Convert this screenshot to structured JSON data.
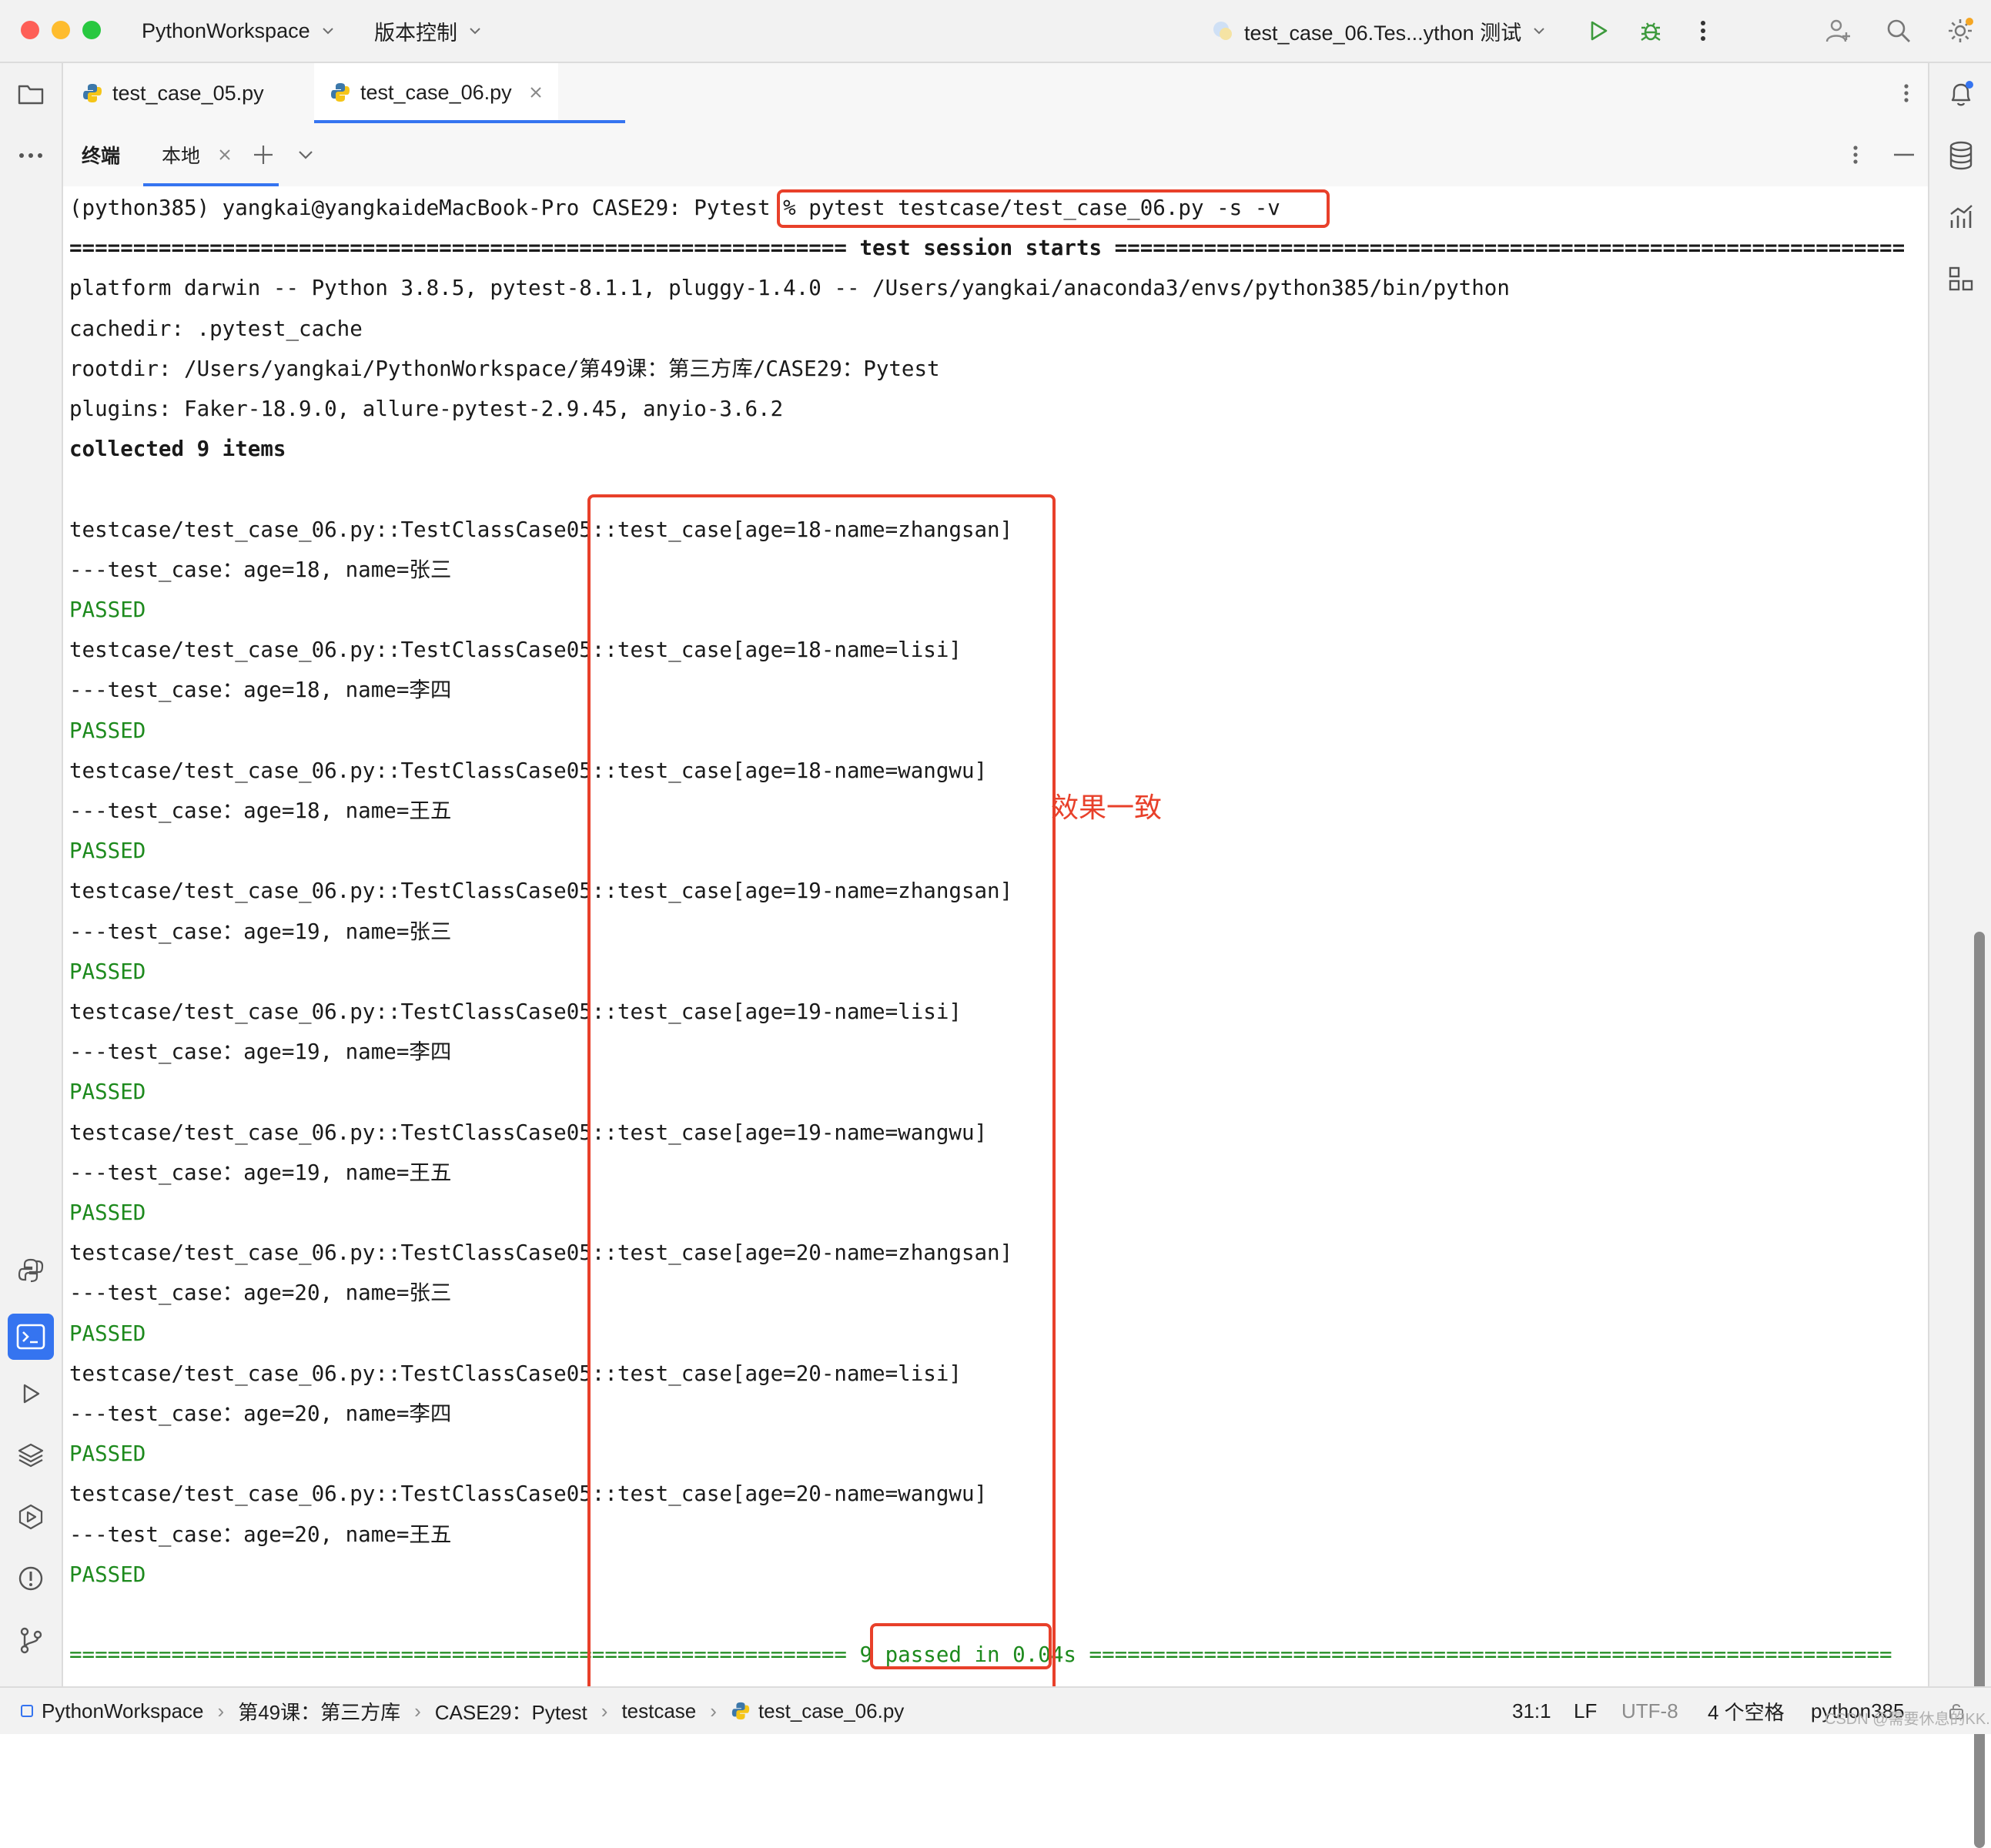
{
  "window": {
    "project": "PythonWorkspace",
    "vcs": "版本控制",
    "run_config": "test_case_06.Tes...ython 测试"
  },
  "editor_tabs": [
    {
      "label": "test_case_05.py",
      "active": false
    },
    {
      "label": "test_case_06.py",
      "active": true
    }
  ],
  "terminal_tabs": {
    "title": "终端",
    "local": "本地"
  },
  "terminal": {
    "lines": [
      {
        "text": "(python385) yangkai@yangkaideMacBook-Pro CASE29: Pytest % pytest testcase/test_case_06.py -s -v",
        "style": "normal"
      },
      {
        "text": "============================================================= test session starts ==============================================================",
        "style": "bold"
      },
      {
        "text": "platform darwin -- Python 3.8.5, pytest-8.1.1, pluggy-1.4.0 -- /Users/yangkai/anaconda3/envs/python385/bin/python",
        "style": "normal"
      },
      {
        "text": "cachedir: .pytest_cache",
        "style": "normal"
      },
      {
        "text": "rootdir: /Users/yangkai/PythonWorkspace/第49课：第三方库/CASE29：Pytest",
        "style": "normal"
      },
      {
        "text": "plugins: Faker-18.9.0, allure-pytest-2.9.45, anyio-3.6.2",
        "style": "normal"
      },
      {
        "text": "collected 9 items",
        "style": "bold"
      },
      {
        "text": "",
        "style": "normal"
      },
      {
        "text": "testcase/test_case_06.py::TestClassCase05::test_case[age=18-name=zhangsan]",
        "style": "normal"
      },
      {
        "text": "---test_case：age=18, name=张三",
        "style": "normal"
      },
      {
        "text": "PASSED",
        "style": "green"
      },
      {
        "text": "testcase/test_case_06.py::TestClassCase05::test_case[age=18-name=lisi]",
        "style": "normal"
      },
      {
        "text": "---test_case：age=18, name=李四",
        "style": "normal"
      },
      {
        "text": "PASSED",
        "style": "green"
      },
      {
        "text": "testcase/test_case_06.py::TestClassCase05::test_case[age=18-name=wangwu]",
        "style": "normal"
      },
      {
        "text": "---test_case：age=18, name=王五",
        "style": "normal"
      },
      {
        "text": "PASSED",
        "style": "green"
      },
      {
        "text": "testcase/test_case_06.py::TestClassCase05::test_case[age=19-name=zhangsan]",
        "style": "normal"
      },
      {
        "text": "---test_case：age=19, name=张三",
        "style": "normal"
      },
      {
        "text": "PASSED",
        "style": "green"
      },
      {
        "text": "testcase/test_case_06.py::TestClassCase05::test_case[age=19-name=lisi]",
        "style": "normal"
      },
      {
        "text": "---test_case：age=19, name=李四",
        "style": "normal"
      },
      {
        "text": "PASSED",
        "style": "green"
      },
      {
        "text": "testcase/test_case_06.py::TestClassCase05::test_case[age=19-name=wangwu]",
        "style": "normal"
      },
      {
        "text": "---test_case：age=19, name=王五",
        "style": "normal"
      },
      {
        "text": "PASSED",
        "style": "green"
      },
      {
        "text": "testcase/test_case_06.py::TestClassCase05::test_case[age=20-name=zhangsan]",
        "style": "normal"
      },
      {
        "text": "---test_case：age=20, name=张三",
        "style": "normal"
      },
      {
        "text": "PASSED",
        "style": "green"
      },
      {
        "text": "testcase/test_case_06.py::TestClassCase05::test_case[age=20-name=lisi]",
        "style": "normal"
      },
      {
        "text": "---test_case：age=20, name=李四",
        "style": "normal"
      },
      {
        "text": "PASSED",
        "style": "green"
      },
      {
        "text": "testcase/test_case_06.py::TestClassCase05::test_case[age=20-name=wangwu]",
        "style": "normal"
      },
      {
        "text": "---test_case：age=20, name=王五",
        "style": "normal"
      },
      {
        "text": "PASSED",
        "style": "green"
      },
      {
        "text": "",
        "style": "normal"
      },
      {
        "text": "============================================================= 9 passed in 0.04s ===============================================================",
        "style": "green"
      }
    ],
    "annotation": "效果一致"
  },
  "statusbar": {
    "breadcrumbs": [
      "PythonWorkspace",
      "第49课：第三方库",
      "CASE29：Pytest",
      "testcase",
      "test_case_06.py"
    ],
    "position": "31:1",
    "line_ending": "LF",
    "encoding": "UTF-8",
    "indent": "4 个空格",
    "interpreter": "python385"
  },
  "watermark": "CSDN @需要休息的KK.",
  "icons": {
    "left_top": [
      "folder-icon",
      "more-icon"
    ],
    "left_bottom": [
      "python-console-icon",
      "terminal-icon",
      "run-icon",
      "layers-icon",
      "services-icon",
      "problems-icon",
      "git-icon"
    ],
    "right": [
      "notifications-icon",
      "database-icon",
      "profiler-icon",
      "structure-icon"
    ]
  },
  "colors": {
    "highlight": "#e8402a",
    "passed": "#1d8a1d",
    "accent": "#3574f0"
  }
}
